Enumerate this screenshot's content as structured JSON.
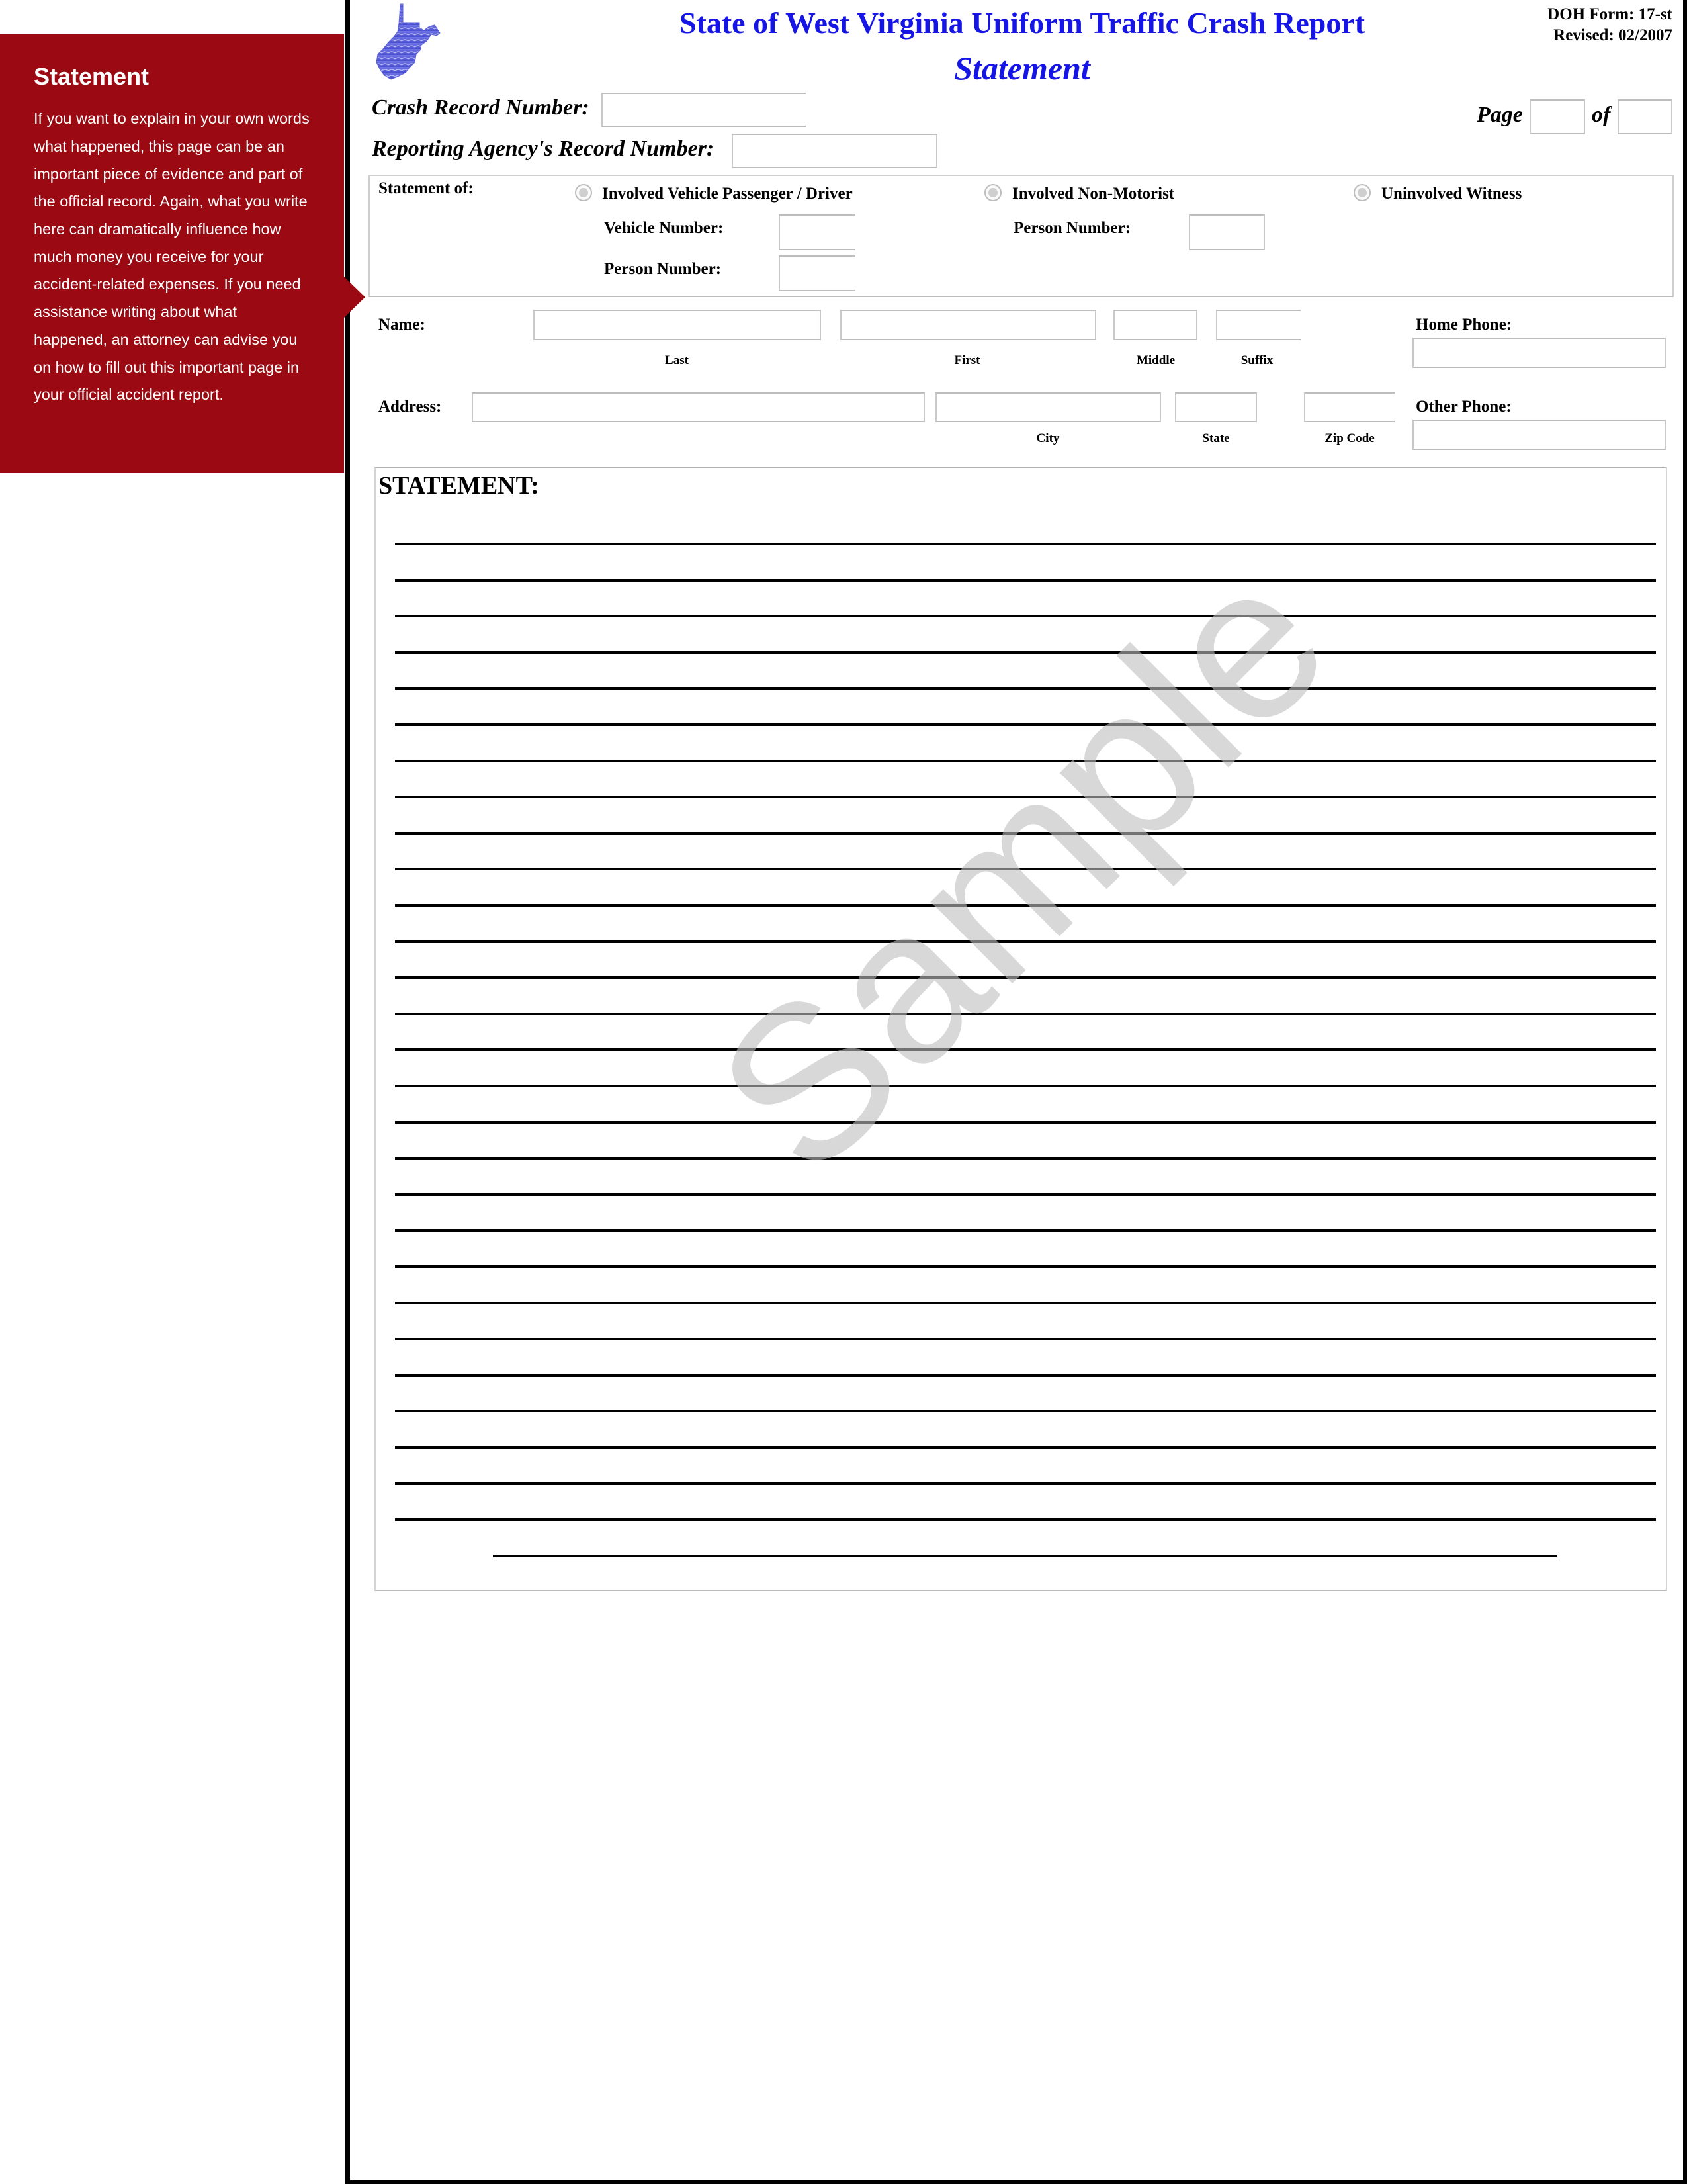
{
  "sidebar": {
    "title": "Statement",
    "text": "If you want to explain in your own words what happened, this page can be an important piece of evidence and part of the official record. Again, what you write here can dramatically influence how much money you receive for your accident-related expenses. If you need assistance writing about what happened, an attorney can advise you on how to fill out this important page in your official accident report.",
    "accent_color": "#9b0a12"
  },
  "header": {
    "logo_icon": "west-virginia-state-map-icon",
    "title": "State of West Virginia Uniform Traffic Crash Report",
    "subtitle": "Statement",
    "form_number": "DOH Form: 17-st",
    "revised": "Revised: 02/2007",
    "title_color": "#1515e6"
  },
  "record": {
    "crash_record_label": "Crash Record Number:",
    "crash_record_value": "",
    "agency_record_label": "Reporting Agency's Record Number:",
    "agency_record_value": "",
    "page_label": "Page",
    "page_value": "",
    "of_label": "of",
    "of_value": ""
  },
  "statement_of": {
    "label": "Statement of:",
    "options": [
      {
        "label": "Involved Vehicle Passenger / Driver",
        "selected": false
      },
      {
        "label": "Involved Non-Motorist",
        "selected": false
      },
      {
        "label": "Uninvolved Witness",
        "selected": false
      }
    ],
    "vehicle_number_label": "Vehicle Number:",
    "vehicle_number_value": "",
    "person_number_label": "Person Number:",
    "person_number_value": "",
    "nonmotorist_person_number_label": "Person Number:",
    "nonmotorist_person_number_value": ""
  },
  "name": {
    "label": "Name:",
    "last_label": "Last",
    "first_label": "First",
    "middle_label": "Middle",
    "suffix_label": "Suffix",
    "last_value": "",
    "first_value": "",
    "middle_value": "",
    "suffix_value": ""
  },
  "address": {
    "label": "Address:",
    "city_label": "City",
    "state_label": "State",
    "zip_label": "Zip Code",
    "street_value": "",
    "city_value": "",
    "state_value": "",
    "zip_value": ""
  },
  "phones": {
    "home_label": "Home Phone:",
    "home_value": "",
    "other_label": "Other Phone:",
    "other_value": ""
  },
  "statement": {
    "heading": "STATEMENT:",
    "line_count": 28,
    "has_signature_line": true
  },
  "watermark": "Sample"
}
